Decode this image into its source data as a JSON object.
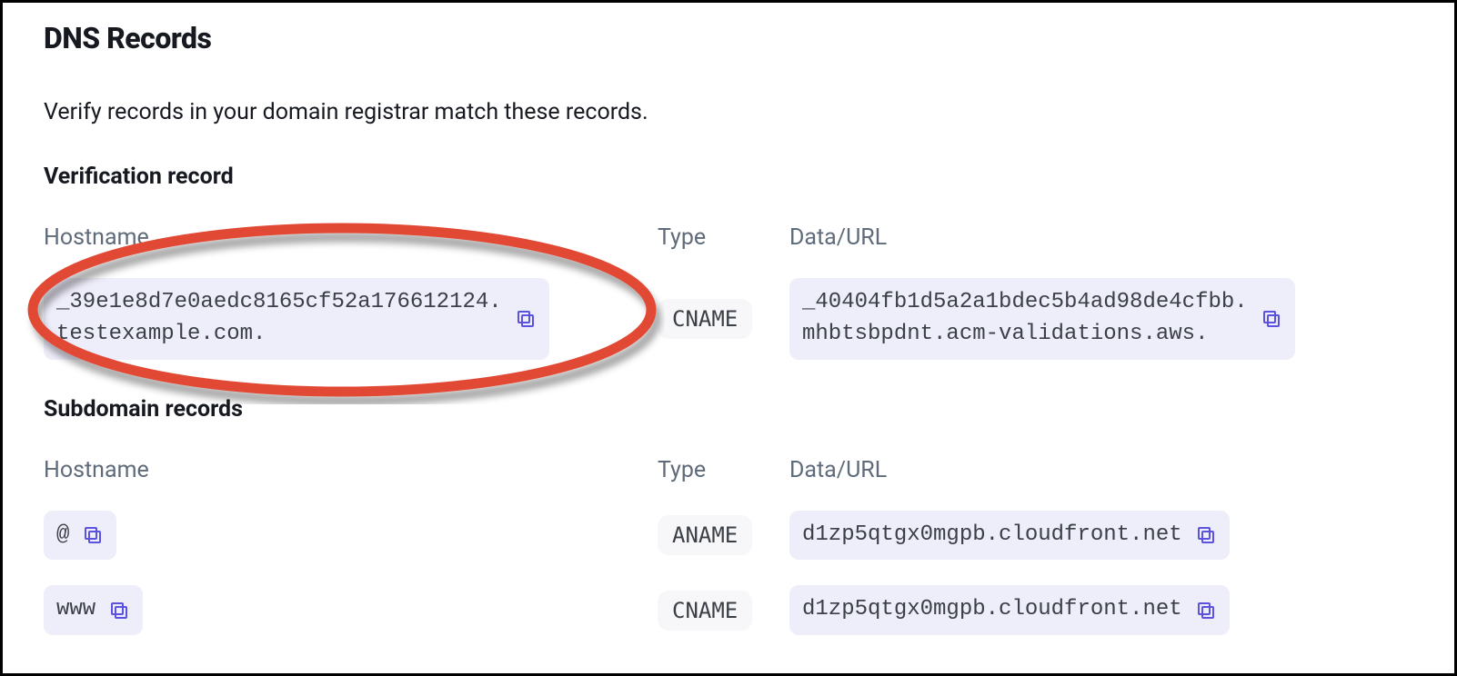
{
  "title": "DNS Records",
  "instruction": "Verify records in your domain registrar match these records.",
  "columns": {
    "hostname": "Hostname",
    "type": "Type",
    "data": "Data/URL"
  },
  "verification": {
    "heading": "Verification record",
    "hostname": "_39e1e8d7e0aedc8165cf52a176612124.\ntestexample.com.",
    "type": "CNAME",
    "data": "_40404fb1d5a2a1bdec5b4ad98de4cfbb.\nmhbtsbpdnt.acm-validations.aws."
  },
  "subdomain": {
    "heading": "Subdomain records",
    "records": [
      {
        "hostname": "@",
        "type": "ANAME",
        "data": "d1zp5qtgx0mgpb.cloudfront.net"
      },
      {
        "hostname": "www",
        "type": "CNAME",
        "data": "d1zp5qtgx0mgpb.cloudfront.net"
      }
    ]
  }
}
